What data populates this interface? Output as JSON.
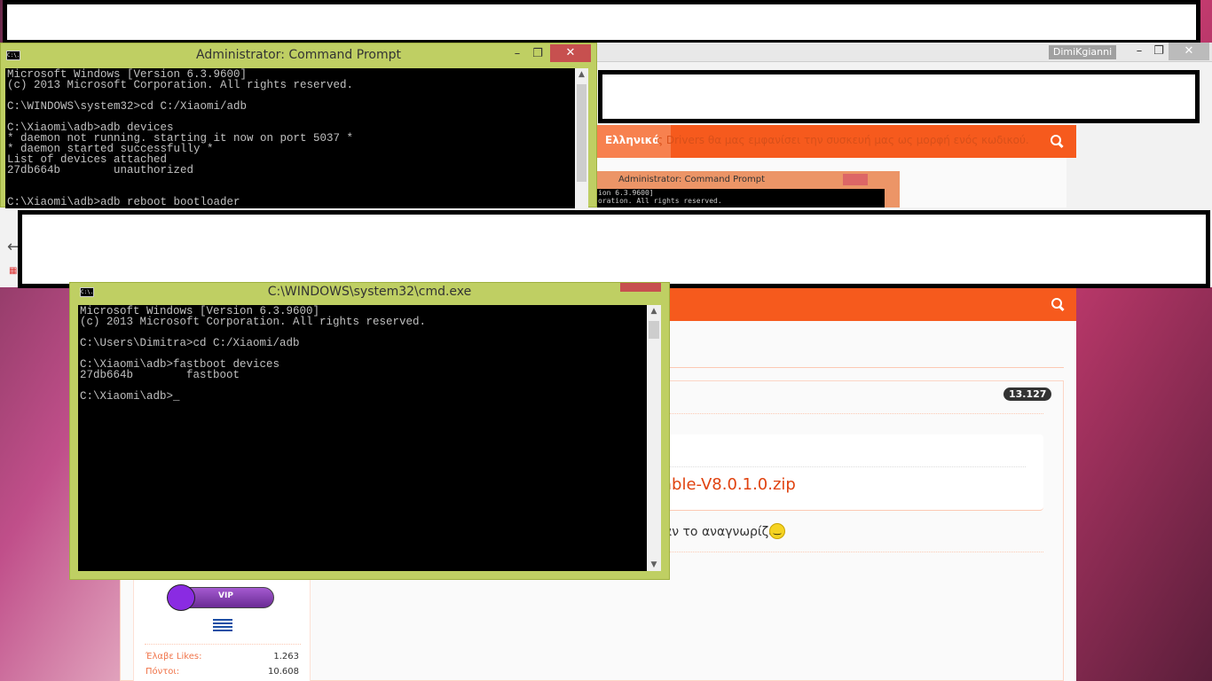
{
  "cmd_admin": {
    "title": "Administrator: Command Prompt",
    "icon_label": "C:\\.",
    "lines": [
      "Microsoft Windows [Version 6.3.9600]",
      "(c) 2013 Microsoft Corporation. All rights reserved.",
      "",
      "C:\\WINDOWS\\system32>cd C:/Xiaomi/adb",
      "",
      "C:\\Xiaomi\\adb>adb devices",
      "* daemon not running. starting it now on port 5037 *",
      "* daemon started successfully *",
      "List of devices attached",
      "27db664b        unauthorized",
      "",
      "",
      "C:\\Xiaomi\\adb>adb reboot bootloader"
    ]
  },
  "cmd_user": {
    "title": "C:\\WINDOWS\\system32\\cmd.exe",
    "icon_label": "C:\\.",
    "lines": [
      "Microsoft Windows [Version 6.3.9600]",
      "(c) 2013 Microsoft Corporation. All rights reserved.",
      "",
      "C:\\Users\\Dimitra>cd C:/Xiaomi/adb",
      "",
      "C:\\Xiaomi\\adb>fastboot devices",
      "27db664b        fastboot",
      "",
      "C:\\Xiaomi\\adb>_"
    ]
  },
  "browser": {
    "user": "DimiKgianni",
    "language": "Ελληνικά",
    "faded_text": "ς Drivers θα μας εμφανίσει την συσκευή μας ως μορφή ενός κωδικού.",
    "embedded_title": "Administrator: Command Prompt",
    "embedded_lines": [
      "ion 6.3.9600]",
      "oration. All rights reserved."
    ],
    "count_badge": "13.127",
    "file_link": "able-V8.0.1.0.zip",
    "post_text": "αν το αναγνωρίζει",
    "vip": "VIP",
    "stats": [
      {
        "label": "Έλαβε Likes:",
        "value": "1.263"
      },
      {
        "label": "Πόντοι:",
        "value": "10.608"
      }
    ]
  },
  "colors": {
    "accent": "#f65a1d",
    "cmd_frame": "#bfcf63"
  }
}
